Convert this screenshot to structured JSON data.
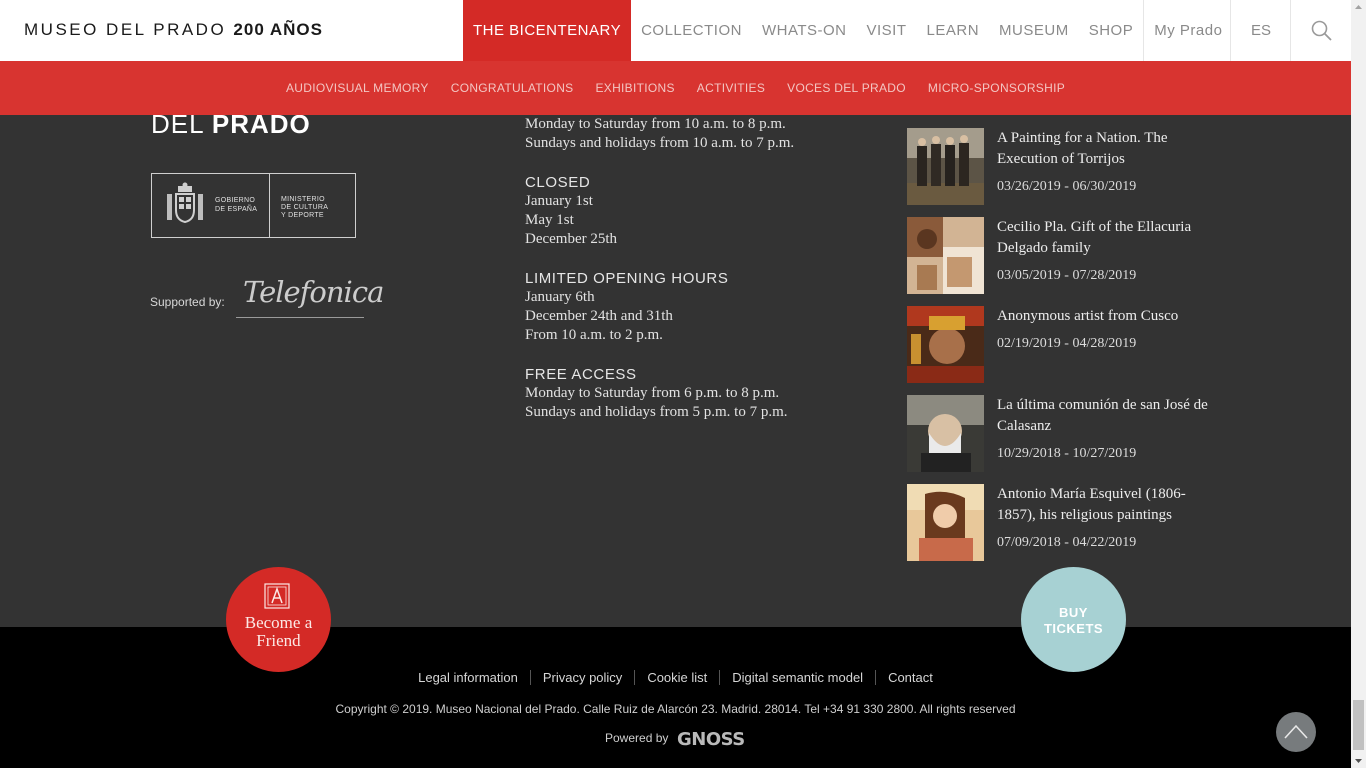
{
  "header": {
    "logo_text": "MUSEO DEL PRADO",
    "logo_bold": "200 AÑOS",
    "nav": [
      "THE BICENTENARY",
      "COLLECTION",
      "WHATS-ON",
      "VISIT",
      "LEARN",
      "MUSEUM",
      "SHOP",
      "My Prado"
    ],
    "active_nav": "THE BICENTENARY",
    "lang": "ES",
    "accent_color": "#d42a26"
  },
  "subnav": [
    "AUDIOVISUAL MEMORY",
    "CONGRATULATIONS",
    "EXHIBITIONS",
    "ACTIVITIES",
    "VOCES DEL PRADO",
    "MICRO-SPONSORSHIP"
  ],
  "brand": {
    "del": "DEL",
    "prado": "PRADO",
    "gov_line1": "GOBIERNO",
    "gov_line2": "DE ESPAÑA",
    "min_line1": "MINISTERIO",
    "min_line2": "DE CULTURA",
    "min_line3": "Y DEPORTE",
    "supported_by": "Supported by:",
    "sponsor": "Telefonica"
  },
  "hours": {
    "open_1": "Monday to Saturday from 10 a.m. to 8 p.m.",
    "open_2": "Sundays and holidays from 10 a.m. to 7 p.m.",
    "closed_heading": "CLOSED",
    "closed": [
      "January 1st",
      "May 1st",
      "December 25th"
    ],
    "limited_heading": "LIMITED OPENING HOURS",
    "limited": [
      "January 6th",
      "December 24th and 31th",
      "From 10 a.m. to 2 p.m."
    ],
    "free_heading": "FREE ACCESS",
    "free": [
      "Monday to Saturday from 6 p.m. to 8 p.m.",
      "Sundays and holidays from 5 p.m. to 7 p.m."
    ]
  },
  "exhibitions": [
    {
      "title": "A Painting for a Nation. The Execution of Torrijos",
      "dates": "03/26/2019 - 06/30/2019",
      "thumb": "painting-torrijos"
    },
    {
      "title": "Cecilio Pla. Gift of the Ellacuria Delgado family",
      "dates": "03/05/2019 - 07/28/2019",
      "thumb": "painting-cecilio-pla"
    },
    {
      "title": "Anonymous artist from Cusco",
      "dates": "02/19/2019 - 04/28/2019",
      "thumb": "painting-cusco"
    },
    {
      "title": "La última comunión de san José de Calasanz",
      "dates": "10/29/2018 - 10/27/2019",
      "thumb": "painting-calasanz"
    },
    {
      "title": "Antonio María Esquivel (1806-1857), his religious paintings",
      "dates": "07/09/2018 - 04/22/2019",
      "thumb": "painting-esquivel"
    }
  ],
  "cta": {
    "friend_line1": "Become a",
    "friend_line2": "Friend",
    "tickets_line1": "BUY",
    "tickets_line2": "TICKETS"
  },
  "footer": {
    "links": [
      "Legal information",
      "Privacy policy",
      "Cookie list",
      "Digital semantic model",
      "Contact"
    ],
    "copyright": "Copyright © 2019. Museo Nacional del Prado. Calle Ruiz de Alarcón 23. Madrid. 28014. Tel +34 91 330 2800. All rights reserved",
    "powered_by": "Powered by",
    "powered_brand": "GNOSS"
  }
}
